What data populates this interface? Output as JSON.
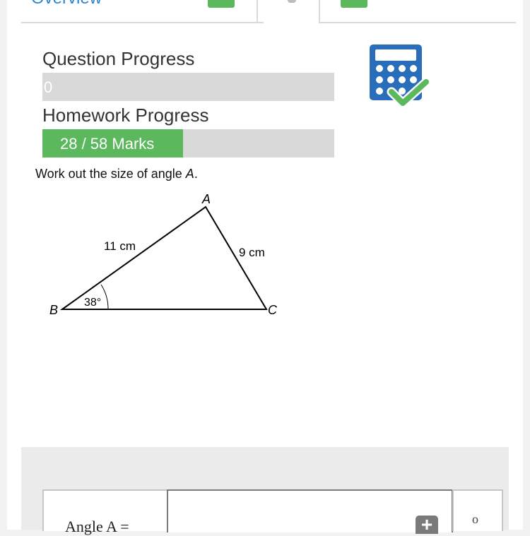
{
  "tabs": {
    "first_label": "Overview"
  },
  "question_progress": {
    "title": "Question Progress",
    "value_text": "0",
    "fraction": 0
  },
  "homework_progress": {
    "title": "Homework Progress",
    "value_text": "28 / 58 Marks",
    "marks": 28,
    "total": 58
  },
  "calculator": {
    "icon": "calculator-allowed-icon",
    "color": "#2a6ebb",
    "check_color": "#5cb85c"
  },
  "question": {
    "prompt_before": "Work out the size of angle ",
    "prompt_var": "A",
    "prompt_after": "."
  },
  "diagram": {
    "vertex_a": "A",
    "vertex_b": "B",
    "vertex_c": "C",
    "side_ab": "11 cm",
    "side_ac": "9 cm",
    "angle_b": "38°"
  },
  "answer": {
    "label": "Angle A =",
    "value": "",
    "unit": "o",
    "add_button_icon": "plus-icon"
  },
  "colors": {
    "accent_blue": "#2a86d1",
    "progress_green": "#5cb85c",
    "bar_gray": "#d9d9d9"
  }
}
